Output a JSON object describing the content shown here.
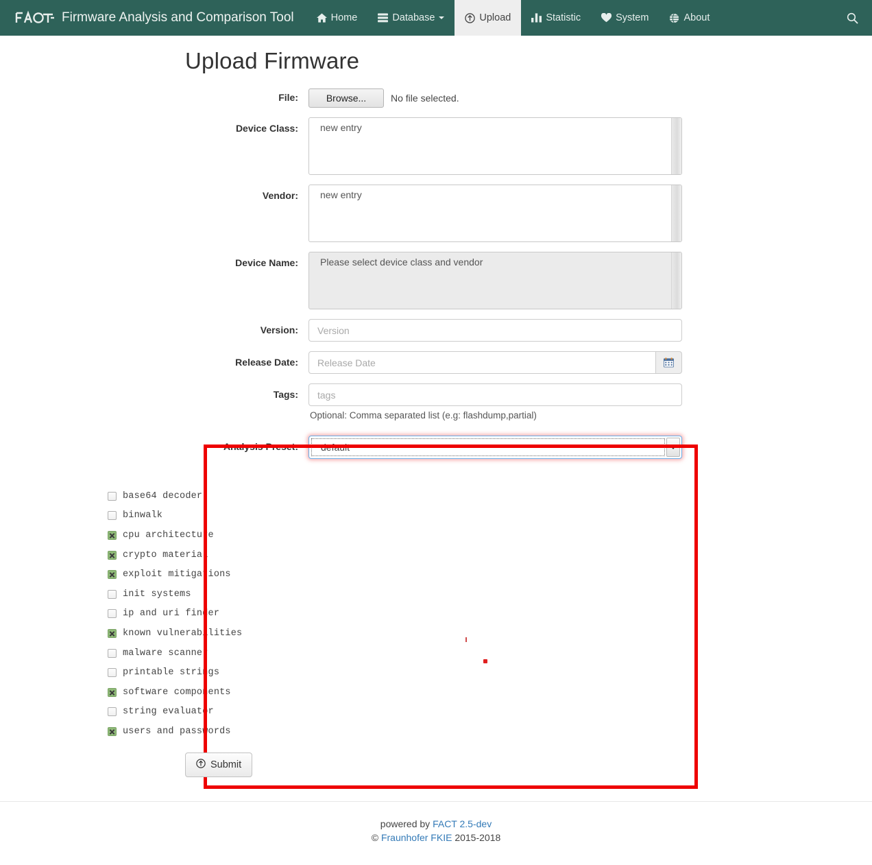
{
  "navbar": {
    "logo_icon": "fact-logo-icon",
    "title": "Firmware Analysis and Comparison Tool",
    "brand_color": "#2e6259",
    "items": [
      {
        "label": "Home",
        "icon": "home-icon",
        "active": false
      },
      {
        "label": "Database",
        "icon": "database-icon",
        "active": false,
        "caret": true
      },
      {
        "label": "Upload",
        "icon": "upload-icon",
        "active": true
      },
      {
        "label": "Statistic",
        "icon": "chart-bar-icon",
        "active": false
      },
      {
        "label": "System",
        "icon": "heart-icon",
        "active": false
      },
      {
        "label": "About",
        "icon": "globe-icon",
        "active": false
      }
    ],
    "search_icon": "search-icon"
  },
  "page": {
    "title": "Upload Firmware"
  },
  "form": {
    "file": {
      "label": "File:",
      "browse_label": "Browse...",
      "status": "No file selected."
    },
    "device_class": {
      "label": "Device Class:",
      "options": [
        "new entry"
      ],
      "selected": "new entry",
      "disabled": false
    },
    "vendor": {
      "label": "Vendor:",
      "options": [
        "new entry"
      ],
      "selected": "new entry",
      "disabled": false
    },
    "device_name": {
      "label": "Device Name:",
      "options": [
        "Please select device class and vendor"
      ],
      "selected": "Please select device class and vendor",
      "disabled": true
    },
    "version": {
      "label": "Version:",
      "value": "",
      "placeholder": "Version"
    },
    "release_date": {
      "label": "Release Date:",
      "value": "",
      "placeholder": "Release Date",
      "addon_icon": "calendar-icon"
    },
    "tags": {
      "label": "Tags:",
      "value": "",
      "placeholder": "tags",
      "helper": "Optional: Comma separated list (e.g: flashdump,partial)"
    },
    "analysis_preset": {
      "label": "Analysis Preset:",
      "selected": "default",
      "options": [
        "default"
      ],
      "focused": true
    },
    "submit": {
      "label": "Submit",
      "icon": "upload-icon"
    }
  },
  "plugins": [
    {
      "name": "base64 decoder",
      "checked": false
    },
    {
      "name": "binwalk",
      "checked": false
    },
    {
      "name": "cpu architecture",
      "checked": true
    },
    {
      "name": "crypto material",
      "checked": true
    },
    {
      "name": "exploit mitigations",
      "checked": true
    },
    {
      "name": "init systems",
      "checked": false
    },
    {
      "name": "ip and uri finder",
      "checked": false
    },
    {
      "name": "known vulnerabilities",
      "checked": true
    },
    {
      "name": "malware scanner",
      "checked": false
    },
    {
      "name": "printable strings",
      "checked": false
    },
    {
      "name": "software components",
      "checked": true
    },
    {
      "name": "string evaluator",
      "checked": false
    },
    {
      "name": "users and passwords",
      "checked": true
    }
  ],
  "highlight": {
    "color": "#ee0000"
  },
  "footer": {
    "powered_prefix": "powered by ",
    "powered_link": "FACT 2.5-dev",
    "copyright_prefix": "© ",
    "copyright_link": "Fraunhofer FKIE",
    "copyright_years": " 2015-2018"
  }
}
